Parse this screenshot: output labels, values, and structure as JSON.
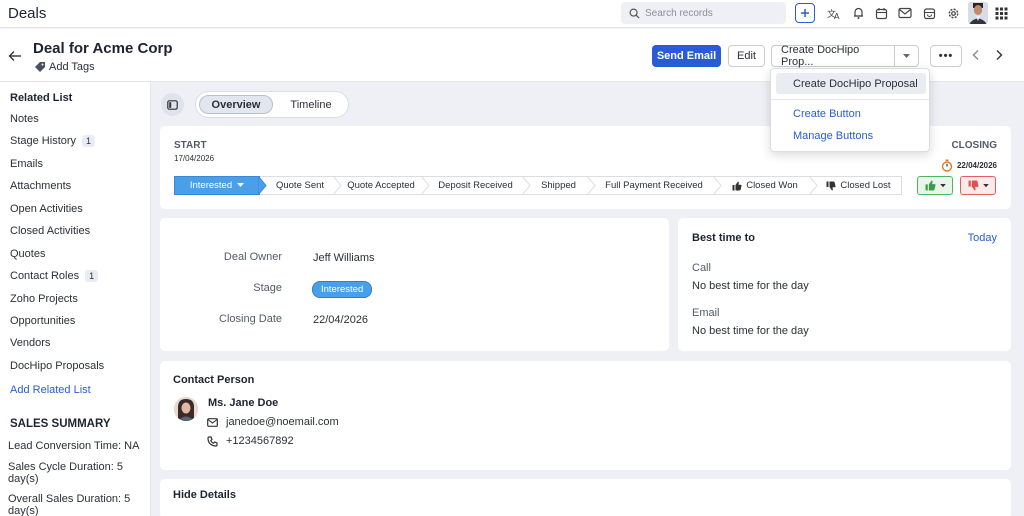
{
  "app": {
    "title": "Deals"
  },
  "topbar": {
    "search_placeholder": "Search records",
    "icons": [
      "search-icon",
      "plus-icon",
      "translate-icon",
      "bell-icon",
      "calendar-icon",
      "mail-icon",
      "store-icon",
      "gear-icon",
      "avatar",
      "apps-grid-icon"
    ]
  },
  "header": {
    "deal_title": "Deal for Acme Corp",
    "add_tags": "Add Tags",
    "send_email": "Send Email",
    "edit": "Edit",
    "create_proposal": "Create DocHipo Prop...",
    "more": "•••"
  },
  "dropdown": {
    "items": [
      {
        "label": "Create DocHipo Proposal"
      },
      {
        "label": "Create Button"
      },
      {
        "label": "Manage Buttons"
      }
    ]
  },
  "sidebar": {
    "related_list_heading": "Related List",
    "items": [
      {
        "label": "Notes"
      },
      {
        "label": "Stage History",
        "count": "1"
      },
      {
        "label": "Emails"
      },
      {
        "label": "Attachments"
      },
      {
        "label": "Open Activities"
      },
      {
        "label": "Closed Activities"
      },
      {
        "label": "Quotes"
      },
      {
        "label": "Contact Roles",
        "count": "1"
      },
      {
        "label": "Zoho Projects"
      },
      {
        "label": "Opportunities"
      },
      {
        "label": "Vendors"
      },
      {
        "label": "DocHipo Proposals"
      }
    ],
    "add_related_list": "Add Related List",
    "sales_summary_heading": "SALES SUMMARY",
    "summary": [
      {
        "text": "Lead Conversion Time: NA"
      },
      {
        "text": "Sales Cycle Duration: 5 day(s)"
      },
      {
        "text": "Overall Sales Duration: 5 day(s)"
      }
    ]
  },
  "tabs": {
    "overview": "Overview",
    "timeline": "Timeline"
  },
  "stages": {
    "start_label": "START",
    "start_date": "17/04/2026",
    "closing_label": "CLOSING",
    "closing_date": "22/04/2026",
    "current": "Interested",
    "items": [
      {
        "label": "Interested"
      },
      {
        "label": "Quote Sent"
      },
      {
        "label": "Quote Accepted"
      },
      {
        "label": "Deposit Received"
      },
      {
        "label": "Shipped"
      },
      {
        "label": "Full Payment Received"
      },
      {
        "label": "Closed Won"
      },
      {
        "label": "Closed Lost"
      }
    ],
    "colors": {
      "active": "#4a9fe9",
      "won": "#53b35f",
      "lost": "#e36060"
    }
  },
  "details": {
    "deal_owner_label": "Deal Owner",
    "deal_owner_value": "Jeff Williams",
    "stage_label": "Stage",
    "stage_value": "Interested",
    "closing_date_label": "Closing Date",
    "closing_date_value": "22/04/2026"
  },
  "best_time": {
    "title": "Best time to",
    "today": "Today",
    "call_label": "Call",
    "call_value": "No best time for the day",
    "email_label": "Email",
    "email_value": "No best time for the day"
  },
  "contact": {
    "title": "Contact Person",
    "name": "Ms. Jane Doe",
    "email": "janedoe@noemail.com",
    "phone": "+1234567892"
  },
  "hide_details": "Hide Details",
  "accent_color": "#2a5bd7"
}
